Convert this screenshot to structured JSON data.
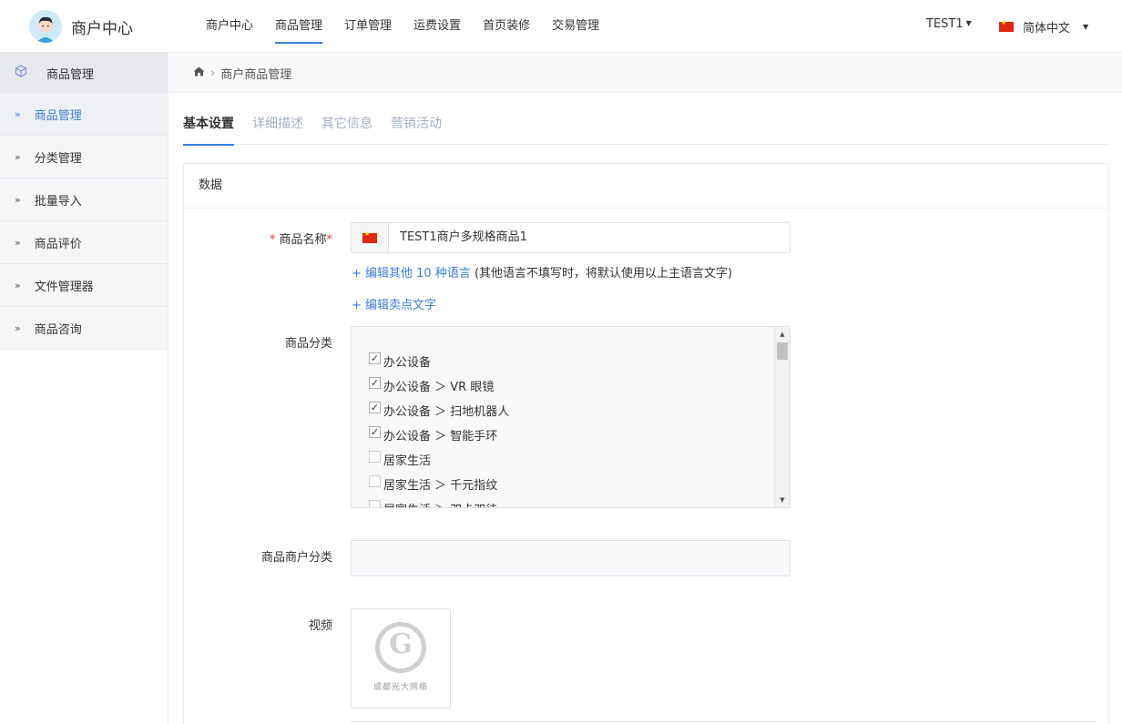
{
  "header": {
    "brand_title": "商户中心",
    "nav": [
      "商户中心",
      "商品管理",
      "订单管理",
      "运费设置",
      "首页装修",
      "交易管理"
    ],
    "active_nav": "商品管理",
    "user": "TEST1",
    "language": "简体中文"
  },
  "sidebar": {
    "section_title": "商品管理",
    "items": [
      {
        "label": "商品管理",
        "active": true
      },
      {
        "label": "分类管理"
      },
      {
        "label": "批量导入"
      },
      {
        "label": "商品评价"
      },
      {
        "label": "文件管理器"
      },
      {
        "label": "商品咨询"
      }
    ]
  },
  "breadcrumb": {
    "current": "商户商品管理"
  },
  "tabs": [
    "基本设置",
    "详细描述",
    "其它信息",
    "营销活动"
  ],
  "active_tab": "基本设置",
  "card": {
    "title": "数据"
  },
  "form": {
    "name_label": "商品名称",
    "name_value": "TEST1商户多规格商品1",
    "edit_languages_link": "+ 编辑其他 10 种语言",
    "edit_languages_note": "(其他语言不填写时，将默认使用以上主语言文字)",
    "edit_selling_link": "+ 编辑卖点文字",
    "category_label": "商品分类",
    "categories": [
      {
        "label": "办公设备",
        "checked": true
      },
      {
        "label": "办公设备 ＞ VR 眼镜",
        "checked": true
      },
      {
        "label": "办公设备 ＞ 扫地机器人",
        "checked": true
      },
      {
        "label": "办公设备 ＞ 智能手环",
        "checked": true
      },
      {
        "label": "居家生活",
        "checked": false
      },
      {
        "label": "居家生活 ＞ 千元指纹",
        "checked": false
      },
      {
        "label": "居家生活 ＞ 双卡双待",
        "checked": false
      }
    ],
    "merchant_category_label": "商品商户分类",
    "video_label": "视频",
    "video_caption": "成都光大网络"
  }
}
